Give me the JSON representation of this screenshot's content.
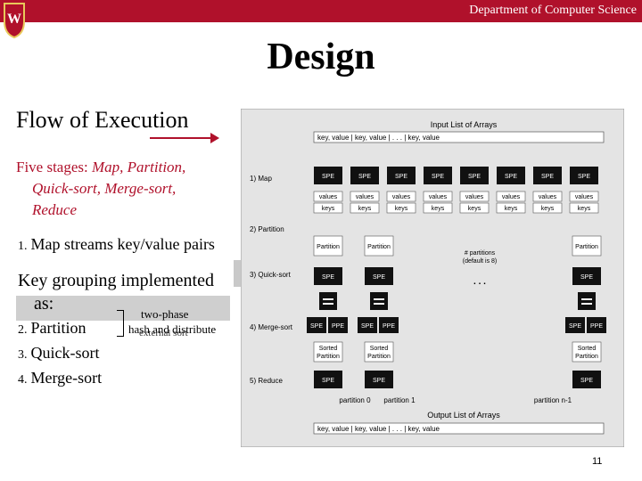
{
  "header": {
    "department": "Department of Computer Science"
  },
  "slide": {
    "title": "Design",
    "subtitle": "Flow of Execution",
    "stages_label": "Five stages:",
    "stages_line1_items": "Map, Partition,",
    "stages_line2": "Quick-sort, Merge-sort,",
    "stages_line3": "Reduce",
    "list_item_1": "Map streams key/value pairs",
    "key_grouping_1": "Key grouping implemented",
    "key_grouping_2": "as:",
    "list_item_2": "Partition",
    "list_item_3": "Quick-sort",
    "list_item_4": "Merge-sort",
    "num_1": "1.",
    "num_2": "2.",
    "num_3": "3.",
    "num_4": "4.",
    "note_two_phase": "two-phase",
    "note_hash": "hash and distribute",
    "note_external": "external sort",
    "page_number": "11"
  },
  "diagram": {
    "input_title": "Input List of Arrays",
    "input_row": "key, value | key, value |   . . .   | key, value",
    "output_title": "Output List of Arrays",
    "output_row": "key, value | key, value |   . . .   | key, value",
    "stage_labels": [
      "1) Map",
      "2) Partition",
      "3) Quick-sort",
      "4) Merge-sort",
      "5) Reduce"
    ],
    "spe": "SPE",
    "ppe": "PPE",
    "values": "values",
    "keys": "keys",
    "partition": "Partition",
    "sorted_partition_1": "Sorted",
    "sorted_partition_2": "Partition",
    "partitions_note_1": "# partitions",
    "partitions_note_2": "(default is 8)",
    "dots": ". . .",
    "partition_0": "partition 0",
    "partition_1": "partition 1",
    "partition_n": "partition n-1"
  },
  "colors": {
    "accent": "#b0112b",
    "spe_box": "#111111",
    "panel": "#e4e4e4"
  }
}
